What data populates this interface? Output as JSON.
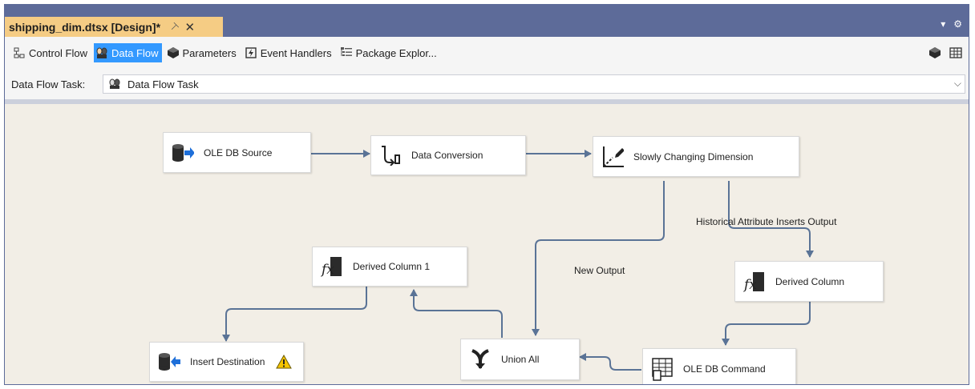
{
  "document_tab": {
    "title": "shipping_dim.dtsx [Design]*",
    "pin_glyph": "⊣",
    "close_glyph": "✕"
  },
  "window_menu": {
    "dropdown_glyph": "▾",
    "settings_glyph": "⚙"
  },
  "designer_tabs": [
    {
      "label": "Control Flow",
      "icon": "control-flow-icon"
    },
    {
      "label": "Data Flow",
      "icon": "data-flow-icon",
      "active": true
    },
    {
      "label": "Parameters",
      "icon": "parameters-icon"
    },
    {
      "label": "Event Handlers",
      "icon": "event-handlers-icon"
    },
    {
      "label": "Package Explor...",
      "icon": "package-explorer-icon"
    }
  ],
  "task_selector": {
    "label": "Data Flow Task:",
    "value": "Data Flow Task",
    "chevron": "⌵"
  },
  "components": {
    "ole_db_source": {
      "label": "OLE DB Source",
      "icon": "ole-db-source-icon"
    },
    "data_conversion": {
      "label": "Data Conversion",
      "icon": "data-conversion-icon"
    },
    "scd": {
      "label": "Slowly Changing Dimension",
      "icon": "slowly-changing-dimension-icon"
    },
    "derived_column_1": {
      "label": "Derived Column 1",
      "icon": "fx-icon"
    },
    "derived_column": {
      "label": "Derived Column",
      "icon": "fx-icon"
    },
    "insert_destination": {
      "label": "Insert Destination",
      "icon": "ole-db-destination-icon",
      "warning": "warning-icon"
    },
    "union_all": {
      "label": "Union All",
      "icon": "union-all-icon"
    },
    "ole_db_command": {
      "label": "OLE DB Command",
      "icon": "ole-db-command-icon"
    }
  },
  "path_labels": {
    "historical": "Historical Attribute Inserts Output",
    "new_output": "New Output"
  },
  "colors": {
    "title_bar": "#5d6b99",
    "active_doc_tab": "#f5cc84",
    "active_designer_tab": "#3399ff",
    "canvas": "#f2eee6",
    "path_line": "#5a7396"
  }
}
